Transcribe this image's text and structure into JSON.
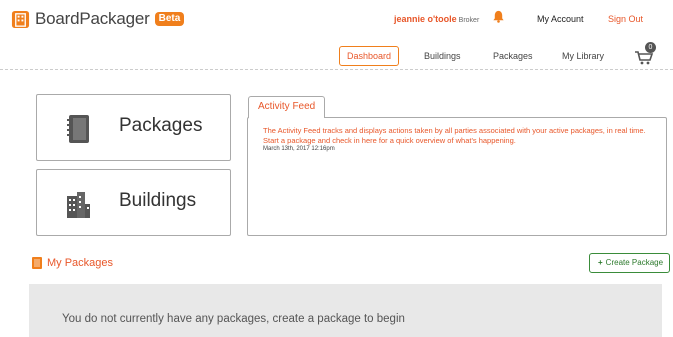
{
  "app": {
    "name": "BoardPackager",
    "badge": "Beta"
  },
  "user": {
    "name": "jeannie o'toole",
    "role": "Broker"
  },
  "top_links": {
    "my_account": "My Account",
    "sign_out": "Sign Out"
  },
  "nav": {
    "dashboard": "Dashboard",
    "buildings": "Buildings",
    "packages": "Packages",
    "library": "My Library",
    "cart_count": "0"
  },
  "tiles": {
    "packages": "Packages",
    "buildings": "Buildings"
  },
  "activity_feed": {
    "tab": "Activity Feed",
    "message": "The Activity Feed tracks and displays actions taken by all parties associated with your active packages, in real time. Start a package and check in here for a quick overview of what's happening.",
    "timestamp": "March 13th, 2017 12:16pm"
  },
  "my_packages": {
    "title": "My Packages",
    "create_label": "Create Package",
    "empty_text": "You do not currently have any packages, create a package to begin"
  },
  "colors": {
    "accent": "#f07f1c",
    "link_orange": "#e8572a",
    "create_green": "#2d7a2d"
  }
}
